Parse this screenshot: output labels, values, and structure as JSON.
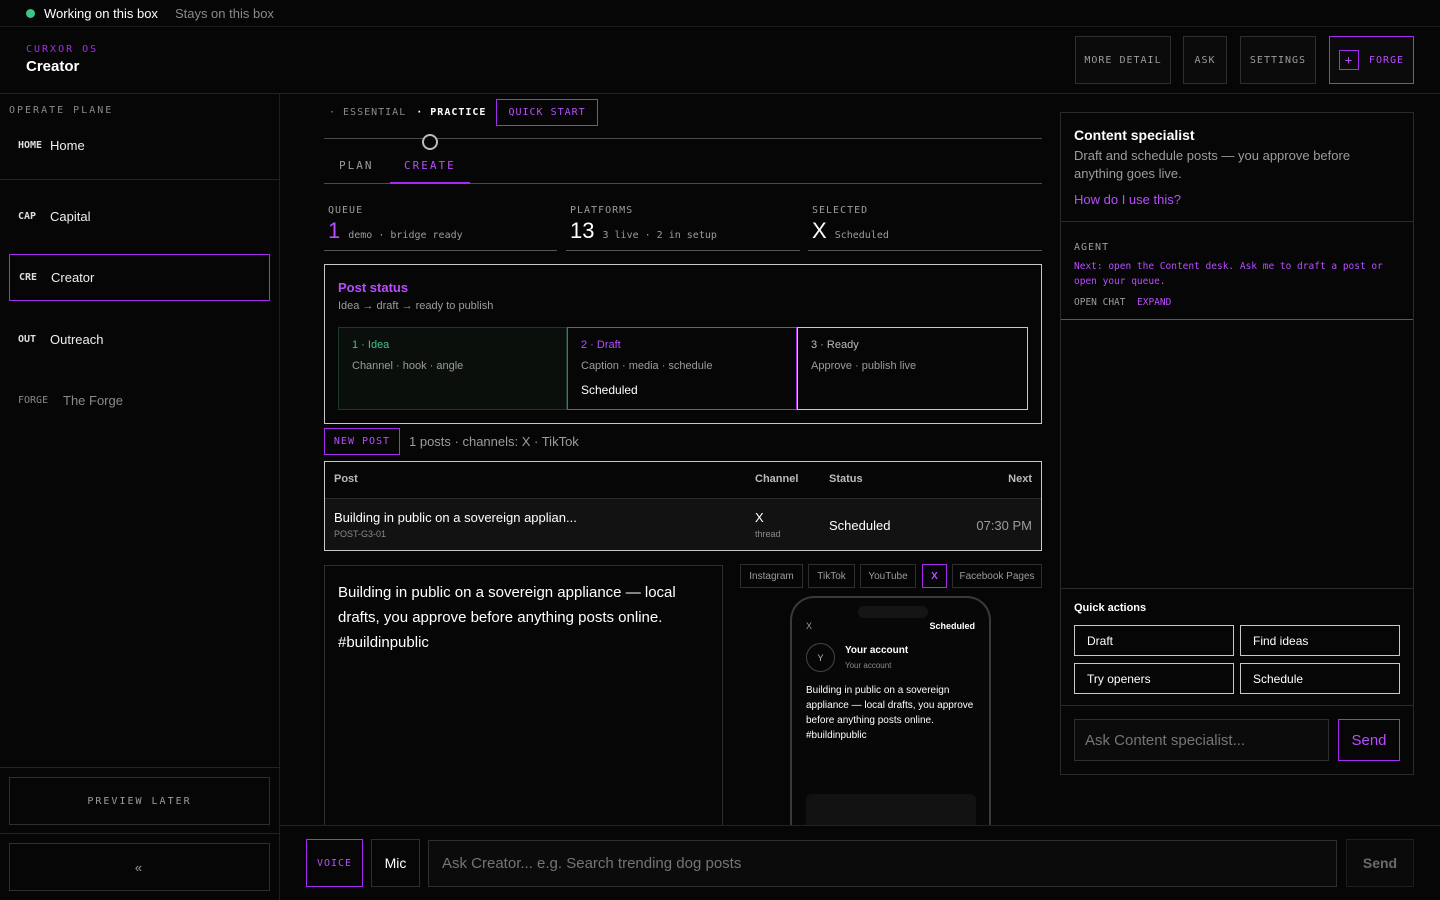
{
  "topbar": {
    "status": "Working on this box",
    "note": "Stays on this box",
    "status_color": "#3ec488"
  },
  "header": {
    "brand_sub": "CURXOR OS",
    "title": "Creator",
    "buttons": [
      "MORE DETAIL",
      "ASK",
      "SETTINGS"
    ],
    "forge_label": "FORGE",
    "forge_icon": "+"
  },
  "sidebar": {
    "label": "OPERATE PLANE",
    "items": [
      {
        "code": "HOME",
        "label": "Home"
      },
      {
        "code": "CAP",
        "label": "Capital"
      },
      {
        "code": "CRE",
        "label": "Creator"
      },
      {
        "code": "OUT",
        "label": "Outreach"
      },
      {
        "code": "FORGE",
        "label": "The Forge"
      }
    ],
    "preview_later": "PREVIEW LATER",
    "collapse": "«"
  },
  "modes": {
    "essential": "· ESSENTIAL",
    "practice": "· PRACTICE",
    "quick_start": "QUICK START"
  },
  "tabs": {
    "plan": "PLAN",
    "create": "CREATE"
  },
  "stats": [
    {
      "label": "QUEUE",
      "value": "1",
      "detail": "demo · bridge ready"
    },
    {
      "label": "PLATFORMS",
      "value": "13",
      "detail": "3 live · 2 in setup"
    },
    {
      "label": "SELECTED",
      "value": "X",
      "detail": "Scheduled"
    }
  ],
  "post_status": {
    "title": "Post status",
    "subtitle": "Idea → draft → ready to publish",
    "steps": [
      {
        "head": "1 · Idea",
        "desc": "Channel · hook · angle",
        "extra": ""
      },
      {
        "head": "2 · Draft",
        "desc": "Caption · media · schedule",
        "extra": "Scheduled"
      },
      {
        "head": "3 · Ready",
        "desc": "Approve · publish live",
        "extra": ""
      }
    ]
  },
  "new_post": {
    "label": "NEW POST",
    "summary": "1 posts · channels: X · TikTok"
  },
  "table": {
    "headers": {
      "post": "Post",
      "channel": "Channel",
      "status": "Status",
      "next": "Next"
    },
    "rows": [
      {
        "title": "Building in public on a sovereign applian...",
        "id": "POST-G3-01",
        "channel": "X",
        "channel_type": "thread",
        "status": "Scheduled",
        "next": "07:30 PM"
      }
    ]
  },
  "editor": {
    "text": "Building in public on a sovereign appliance — local drafts, you approve before anything posts online. #buildinpublic"
  },
  "platform_tabs": [
    "Instagram",
    "TikTok",
    "YouTube",
    "X",
    "Facebook Pages"
  ],
  "preview": {
    "platform": "X",
    "status": "Scheduled",
    "avatar": "Y",
    "account": "Your account",
    "handle": "Your account",
    "body": "Building in public on a sovereign appliance — local drafts, you approve before anything posts online. #buildinpublic"
  },
  "specialist": {
    "title": "Content specialist",
    "desc": "Draft and schedule posts — you approve before anything goes live.",
    "link": "How do I use this?",
    "agent_label": "AGENT",
    "agent_msg": "Next: open the Content desk. Ask me to draft a post or open your queue.",
    "open_chat": "OPEN CHAT",
    "expand": "EXPAND",
    "quick_actions_label": "Quick actions",
    "quick_actions": [
      "Draft",
      "Find ideas",
      "Try openers",
      "Schedule"
    ],
    "ask_placeholder": "Ask Content specialist...",
    "send": "Send"
  },
  "bottom": {
    "voice": "VOICE",
    "mic": "Mic",
    "placeholder": "Ask Creator... e.g. Search trending dog posts",
    "send": "Send"
  },
  "colors": {
    "accent": "#a52bf0",
    "green": "#3ec488"
  }
}
